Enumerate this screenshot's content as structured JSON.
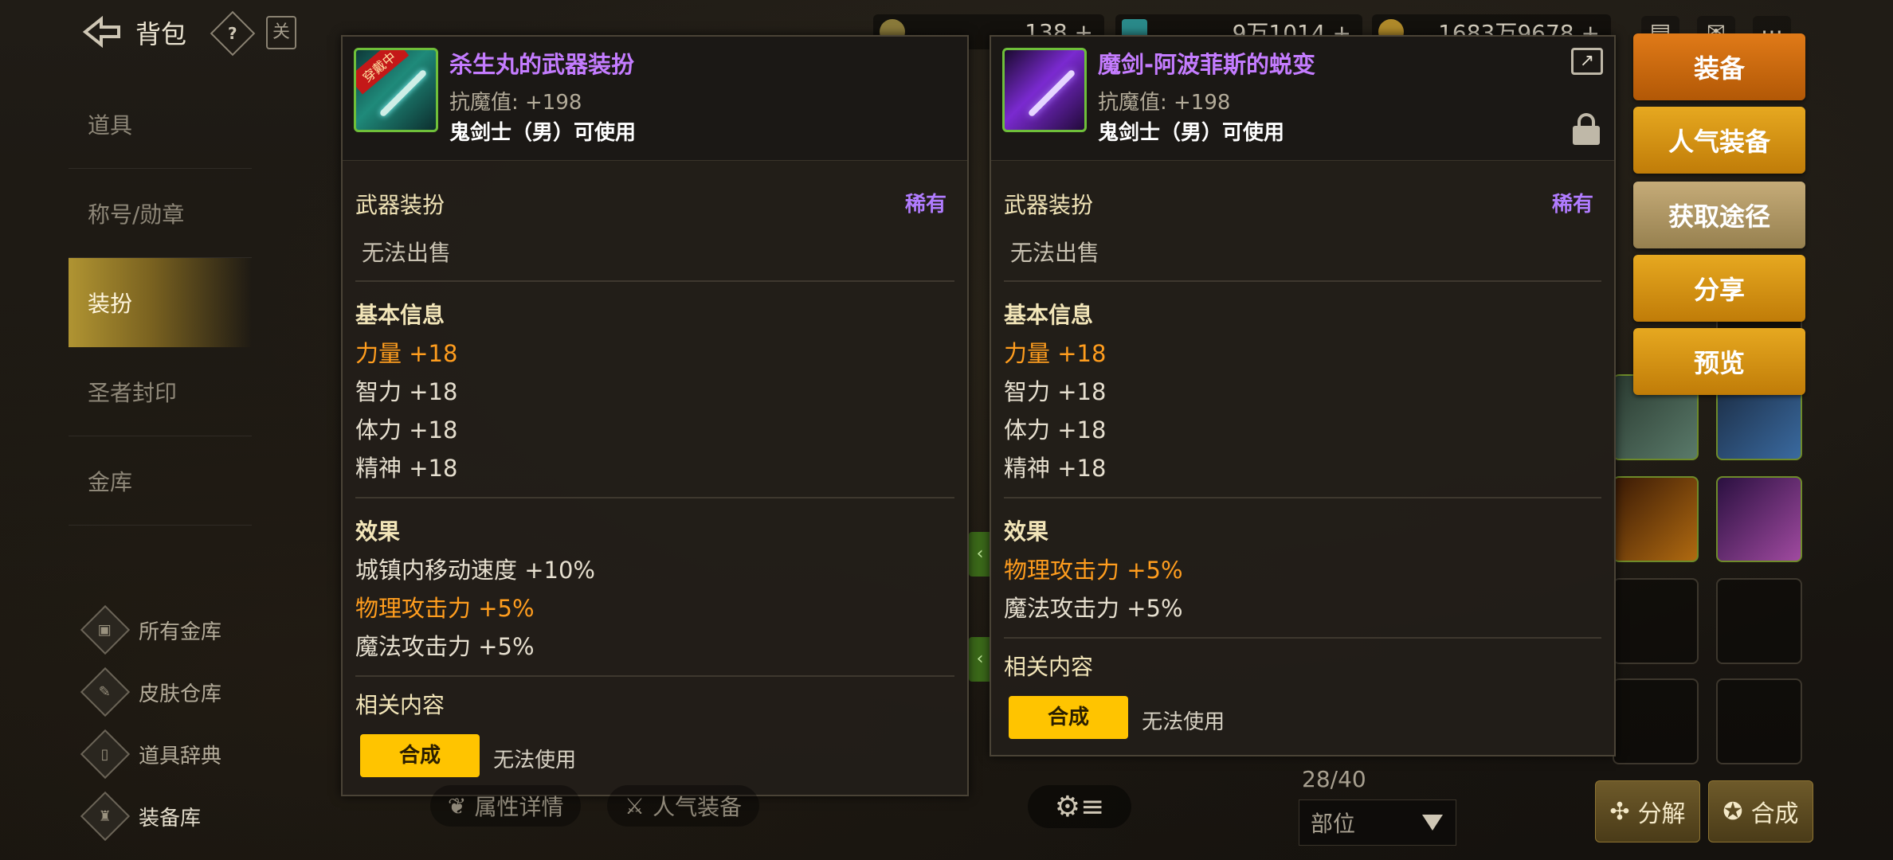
{
  "header": {
    "title": "背包",
    "help_glyph": "?",
    "calendar_glyph": "关",
    "currencies": [
      {
        "icon": "coin-icon",
        "value": "138 +"
      },
      {
        "icon": "crystal-icon",
        "value": "9万1014 +"
      },
      {
        "icon": "gold-icon",
        "value": "1683万9678 +"
      }
    ],
    "right_icons": [
      "shop-icon",
      "mail-icon",
      "menu-icon"
    ]
  },
  "left_nav": {
    "items": [
      {
        "label": "道具"
      },
      {
        "label": "称号/勋章"
      },
      {
        "label": "装扮",
        "active": true
      },
      {
        "label": "圣者封印"
      },
      {
        "label": "金库"
      }
    ]
  },
  "side_links": [
    {
      "label": "所有金库",
      "icon": "vault-icon"
    },
    {
      "label": "皮肤仓库",
      "icon": "brush-icon"
    },
    {
      "label": "道具辞典",
      "icon": "dictionary-icon"
    },
    {
      "label": "装备库",
      "icon": "armor-icon"
    }
  ],
  "bottom": {
    "attr_detail": "属性详情",
    "popular_equip": "人气装备",
    "count": "28/40",
    "slot_dropdown": "部位",
    "decompose": "分解",
    "synthesize": "合成"
  },
  "panel_left": {
    "equipped_tag": "穿戴中",
    "name": "杀生丸的武器装扮",
    "resist_label": "抗魔值: +198",
    "class_req": "鬼剑士（男）可使用",
    "category": "武器装扮",
    "rarity": "稀有",
    "sell": "无法出售",
    "basic_title": "基本信息",
    "stats": [
      {
        "name": "力量",
        "value": "+18",
        "highlight": true
      },
      {
        "name": "智力",
        "value": "+18"
      },
      {
        "name": "体力",
        "value": "+18"
      },
      {
        "name": "精神",
        "value": "+18"
      }
    ],
    "effect_title": "效果",
    "effects": [
      {
        "name": "城镇内移动速度",
        "value": "+10%"
      },
      {
        "name": "物理攻击力",
        "value": "+5%",
        "highlight": true
      },
      {
        "name": "魔法攻击力",
        "value": "+5%"
      }
    ],
    "related_title": "相关内容",
    "synth_button": "合成",
    "synth_note": "无法使用"
  },
  "panel_right": {
    "name": "魔剑-阿波菲斯的蜕变",
    "resist_label": "抗魔值: +198",
    "class_req": "鬼剑士（男）可使用",
    "category": "武器装扮",
    "rarity": "稀有",
    "sell": "无法出售",
    "basic_title": "基本信息",
    "stats": [
      {
        "name": "力量",
        "value": "+18",
        "highlight": true
      },
      {
        "name": "智力",
        "value": "+18"
      },
      {
        "name": "体力",
        "value": "+18"
      },
      {
        "name": "精神",
        "value": "+18"
      }
    ],
    "effect_title": "效果",
    "effects": [
      {
        "name": "物理攻击力",
        "value": "+5%",
        "highlight": true
      },
      {
        "name": "魔法攻击力",
        "value": "+5%"
      }
    ],
    "related_title": "相关内容",
    "synth_button": "合成",
    "synth_note": "无法使用",
    "share_glyph": "↗"
  },
  "actions": {
    "equip": "装备",
    "popular": "人气装备",
    "obtain": "获取途径",
    "share": "分享",
    "preview": "预览"
  },
  "colors": {
    "rarity_purple": "#b17cff",
    "highlight_orange": "#ff9d1e",
    "synth_yellow": "#ffc400",
    "equip_orange": "#e07a18"
  }
}
